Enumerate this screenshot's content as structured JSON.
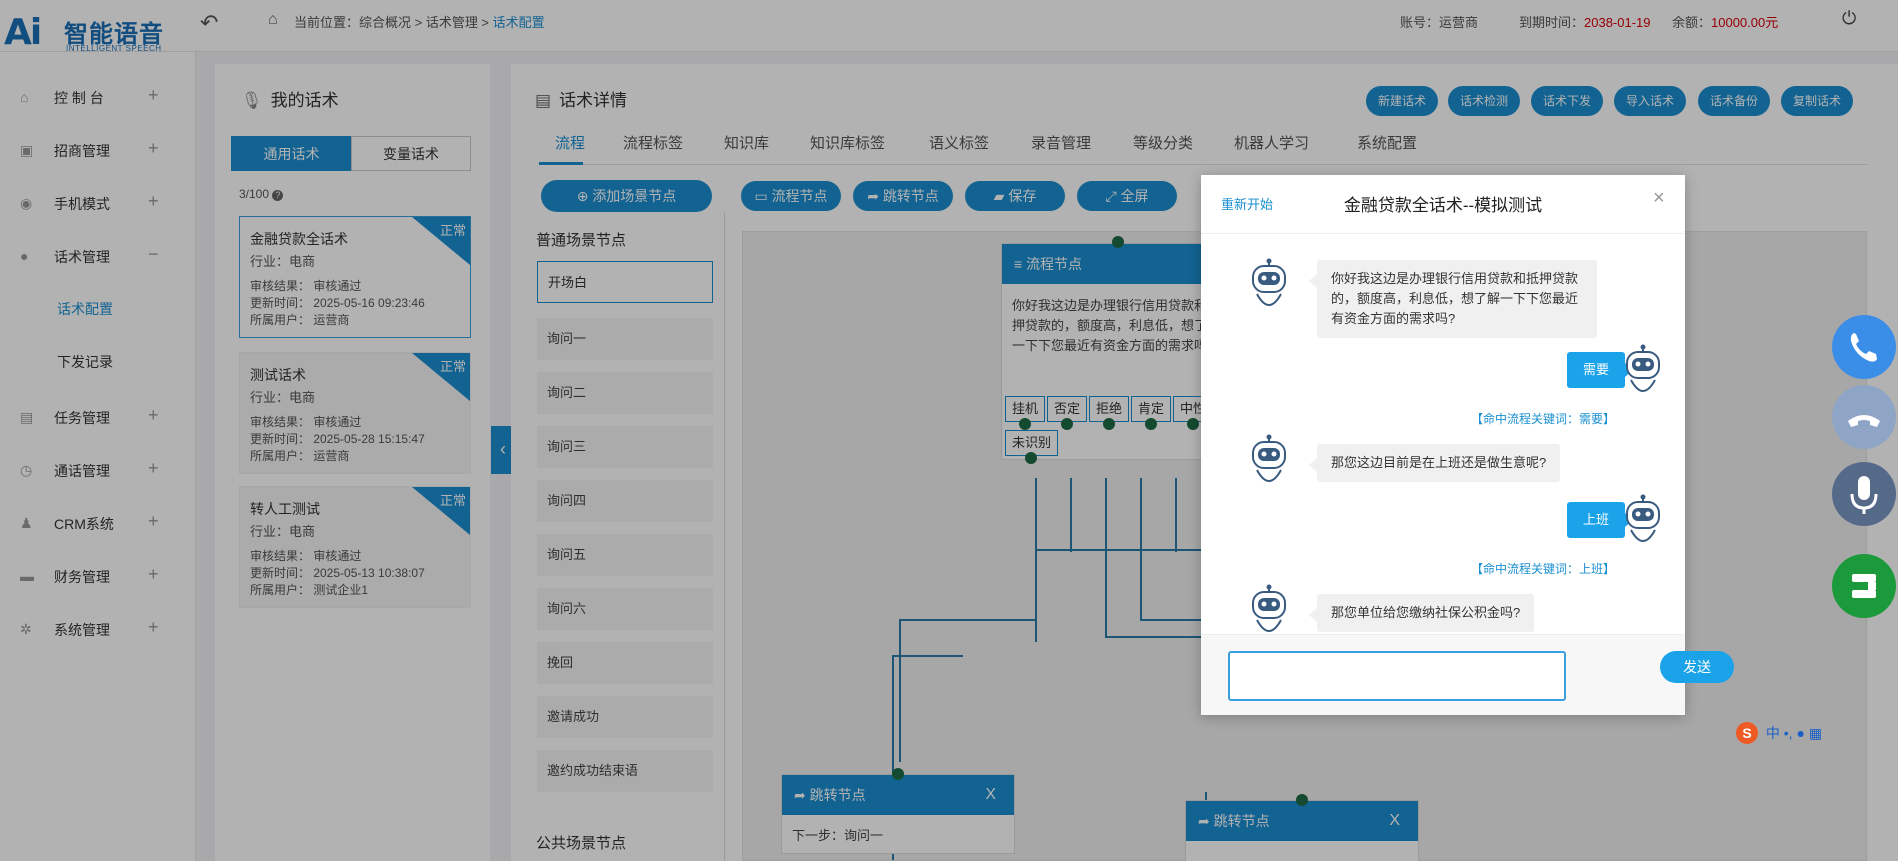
{
  "app": {
    "logo_cn": "智能语音",
    "logo_en": "INTELLIGENT SPEECH"
  },
  "breadcrumb": {
    "prefix": "当前位置：综合概况 > 话术管理 > ",
    "current": "话术配置"
  },
  "account": {
    "label": "账号：",
    "value": "运营商",
    "expire_label": "到期时间：",
    "expire_value": "2038-01-19",
    "balance_label": "余额：",
    "balance_value": "10000.00元"
  },
  "sidebar": {
    "items": [
      {
        "label": "控 制 台",
        "toggle": "+"
      },
      {
        "label": "招商管理",
        "toggle": "+"
      },
      {
        "label": "手机模式",
        "toggle": "+"
      },
      {
        "label": "话术管理",
        "toggle": "−"
      },
      {
        "label": "任务管理",
        "toggle": "+"
      },
      {
        "label": "通话管理",
        "toggle": "+"
      },
      {
        "label": "CRM系统",
        "toggle": "+"
      },
      {
        "label": "财务管理",
        "toggle": "+"
      },
      {
        "label": "系统管理",
        "toggle": "+"
      }
    ],
    "subitems": [
      {
        "label": "话术配置"
      },
      {
        "label": "下发记录"
      }
    ]
  },
  "my_scripts": {
    "title": "我的话术",
    "tabs": [
      {
        "label": "通用话术"
      },
      {
        "label": "变量话术"
      }
    ],
    "count": "3/100",
    "cards": [
      {
        "name": "金融贷款全话术",
        "industry": "行业：电商",
        "review": "审核结果：  审核通过",
        "updated": "更新时间：  2025-05-16 09:23:46",
        "owner": "所属用户：  运营商",
        "status": "正常"
      },
      {
        "name": "测试话术",
        "industry": "行业：电商",
        "review": "审核结果：  审核通过",
        "updated": "更新时间：  2025-05-28 15:15:47",
        "owner": "所属用户：  运营商",
        "status": "正常"
      },
      {
        "name": "转人工测试",
        "industry": "行业：电商",
        "review": "审核结果：  审核通过",
        "updated": "更新时间：  2025-05-13 10:38:07",
        "owner": "所属用户：  测试企业1",
        "status": "正常"
      }
    ]
  },
  "detail": {
    "title": "话术详情",
    "actions": [
      {
        "label": "新建话术"
      },
      {
        "label": "话术检测"
      },
      {
        "label": "话术下发"
      },
      {
        "label": "导入话术"
      },
      {
        "label": "话术备份"
      },
      {
        "label": "复制话术"
      }
    ],
    "tabs": [
      {
        "label": "流程"
      },
      {
        "label": "流程标签"
      },
      {
        "label": "知识库"
      },
      {
        "label": "知识库标签"
      },
      {
        "label": "语义标签"
      },
      {
        "label": "录音管理"
      },
      {
        "label": "等级分类"
      },
      {
        "label": "机器人学习"
      },
      {
        "label": "系统配置"
      }
    ],
    "add_scene": "添加场景节点",
    "normal_nodes_title": "普通场景节点",
    "normal_nodes": [
      {
        "label": "开场白"
      },
      {
        "label": "询问一"
      },
      {
        "label": "询问二"
      },
      {
        "label": "询问三"
      },
      {
        "label": "询问四"
      },
      {
        "label": "询问五"
      },
      {
        "label": "询问六"
      },
      {
        "label": "挽回"
      },
      {
        "label": "邀请成功"
      },
      {
        "label": "邀约成功结束语"
      }
    ],
    "public_nodes_title": "公共场景节点",
    "toolbar": [
      {
        "label": "流程节点"
      },
      {
        "label": "跳转节点"
      },
      {
        "label": "保存"
      },
      {
        "label": "全屏"
      }
    ]
  },
  "flow_node": {
    "title": "流程节点",
    "text": "你好我这边是办理银行信用贷款和抵押贷款的，额度高，利息低，想了解一下下您最近有资金方面的需求吗?",
    "keywords": [
      {
        "label": "挂机"
      },
      {
        "label": "否定"
      },
      {
        "label": "拒绝"
      },
      {
        "label": "肯定"
      },
      {
        "label": "中性"
      },
      {
        "label": "未识别"
      }
    ]
  },
  "jump_nodes": [
    {
      "title": "跳转节点",
      "close": "X",
      "next": "下一步：询问一"
    },
    {
      "title": "跳转节点",
      "close": "X"
    }
  ],
  "modal": {
    "restart": "重新开始",
    "title": "金融贷款全话术--模拟测试",
    "close": "×",
    "messages": [
      {
        "role": "bot",
        "text": "你好我这边是办理银行信用贷款和抵押贷款的，额度高，利息低，想了解一下下您最近有资金方面的需求吗?"
      },
      {
        "role": "user",
        "text": "需要"
      },
      {
        "role": "hit",
        "text": "【命中流程关键词：需要】"
      },
      {
        "role": "bot",
        "text": "那您这边目前是在上班还是做生意呢?"
      },
      {
        "role": "user",
        "text": "上班"
      },
      {
        "role": "hit",
        "text": "【命中流程关键词：上班】"
      },
      {
        "role": "bot",
        "text": "那您单位给您缴纳社保公积金吗?"
      }
    ],
    "input_value": "",
    "send": "发送"
  },
  "ime": {
    "label": "中"
  },
  "colors": {
    "primary": "#1a8fd1",
    "user_bubble": "#1aa3e8",
    "call_green": "#1a9a3a",
    "red": "#d9000a"
  }
}
